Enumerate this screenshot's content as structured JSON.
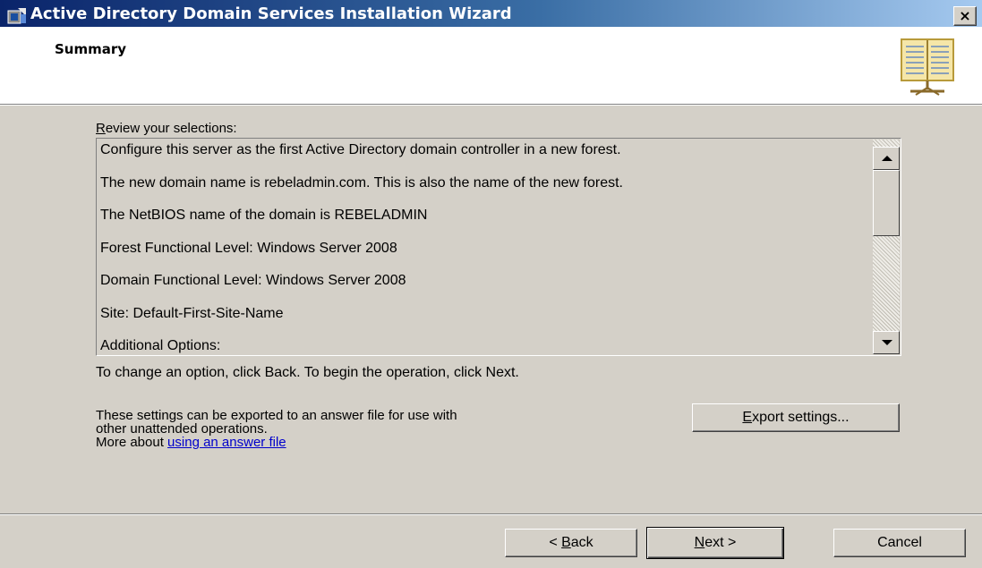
{
  "window": {
    "title": "Active Directory Domain Services Installation Wizard",
    "close_glyph": "×",
    "icon": "wizard-app-icon"
  },
  "header": {
    "title": "Summary",
    "icon": "book-icon"
  },
  "review": {
    "label_accel": "R",
    "label_rest": "eview your selections:",
    "lines": [
      "Configure this server as the first Active Directory domain controller in a new forest.",
      "The new domain name is rebeladmin.com. This is also the name of the new forest.",
      "The NetBIOS name of the domain is REBELADMIN",
      "Forest Functional Level: Windows Server 2008",
      "Domain Functional Level: Windows Server 2008",
      "Site: Default-First-Site-Name",
      "Additional Options:"
    ]
  },
  "instructions": "To change an option, click Back. To begin the operation, click Next.",
  "export": {
    "description_line1": "These settings can be exported to an answer file for use with",
    "description_line2": "other unattended operations.",
    "more_about": "More about ",
    "link_text": "using an answer file",
    "button_accel": "E",
    "button_rest": "xport settings..."
  },
  "buttons": {
    "back_prefix": "< ",
    "back_accel": "B",
    "back_rest": "ack",
    "next_accel": "N",
    "next_rest": "ext >",
    "cancel": "Cancel"
  },
  "colors": {
    "dialog_bg": "#d4d0c8",
    "title_start": "#0a246a",
    "title_end": "#a6caf0",
    "link": "#0000cc"
  }
}
